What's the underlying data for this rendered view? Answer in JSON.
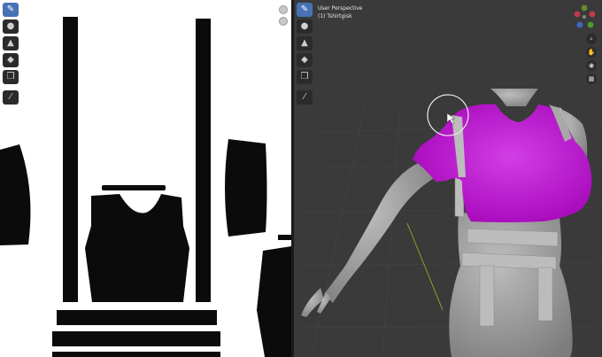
{
  "uv_editor": {
    "tools": [
      {
        "icon": "brush-icon",
        "glyph": "✎",
        "active": true
      },
      {
        "icon": "drop-icon",
        "glyph": "●",
        "active": false
      },
      {
        "icon": "smear-icon",
        "glyph": "▲",
        "active": false
      },
      {
        "icon": "fill-icon",
        "glyph": "◆",
        "active": false
      },
      {
        "icon": "clone-icon",
        "glyph": "❒",
        "active": false
      },
      {
        "icon": "annotate-icon",
        "glyph": "⁄",
        "active": false
      }
    ]
  },
  "viewport": {
    "view_name": "User Perspective",
    "object_name": "(1) Tshirtgisk",
    "colors": {
      "shirt": "#b400c8",
      "body": "#9a9a9a",
      "background": "#3a3a3a"
    },
    "tools": [
      {
        "icon": "brush-icon",
        "glyph": "✎",
        "active": true
      },
      {
        "icon": "drop-icon",
        "glyph": "●",
        "active": false
      },
      {
        "icon": "smear-icon",
        "glyph": "▲",
        "active": false
      },
      {
        "icon": "fill-icon",
        "glyph": "◆",
        "active": false
      },
      {
        "icon": "clone-icon",
        "glyph": "❒",
        "active": false
      },
      {
        "icon": "annotate-icon",
        "glyph": "⁄",
        "active": false
      }
    ],
    "nav": [
      {
        "icon": "zoom-icon",
        "glyph": "⌕"
      },
      {
        "icon": "pan-hand-icon",
        "glyph": "✋"
      },
      {
        "icon": "camera-icon",
        "glyph": "◉"
      },
      {
        "icon": "grid-icon",
        "glyph": "▦"
      }
    ]
  }
}
